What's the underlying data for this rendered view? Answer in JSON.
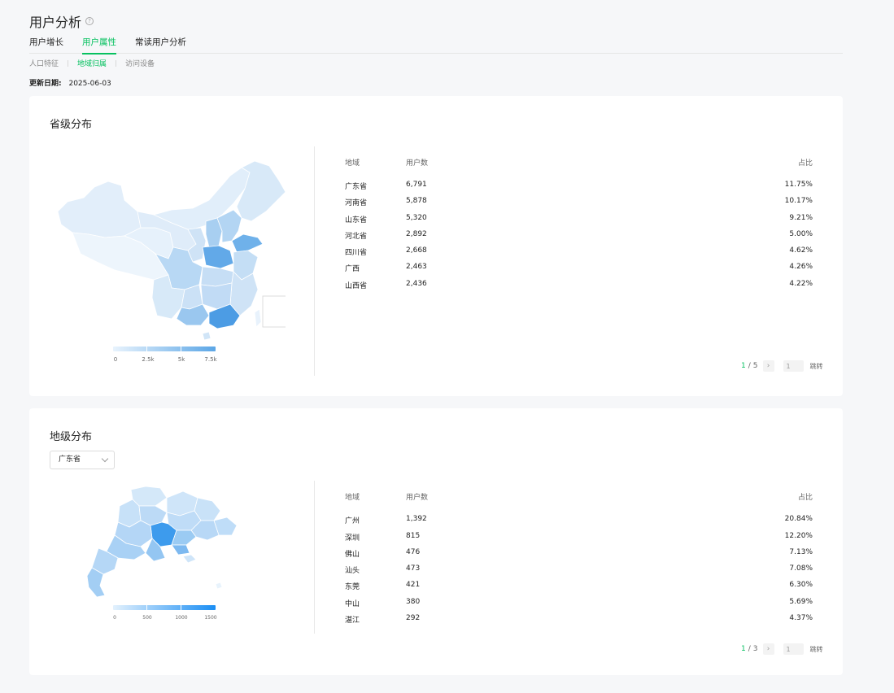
{
  "page": {
    "title": "用户分析",
    "help_icon": "question-circle-icon"
  },
  "main_tabs": [
    {
      "label": "用户增长",
      "active": false
    },
    {
      "label": "用户属性",
      "active": true
    },
    {
      "label": "常读用户分析",
      "active": false
    }
  ],
  "sub_tabs": [
    {
      "label": "人口特征",
      "active": false
    },
    {
      "label": "地域归属",
      "active": true
    },
    {
      "label": "访问设备",
      "active": false
    }
  ],
  "update": {
    "label": "更新日期:",
    "date": "2025-06-03"
  },
  "province_card": {
    "title": "省级分布",
    "legend": [
      "0",
      "2.5k",
      "5k",
      "7.5k"
    ],
    "columns": {
      "region": "地域",
      "users": "用户数",
      "pct": "占比"
    },
    "rows": [
      {
        "region": "广东省",
        "users": "6,791",
        "pct": "11.75%"
      },
      {
        "region": "河南省",
        "users": "5,878",
        "pct": "10.17%"
      },
      {
        "region": "山东省",
        "users": "5,320",
        "pct": "9.21%"
      },
      {
        "region": "河北省",
        "users": "2,892",
        "pct": "5.00%"
      },
      {
        "region": "四川省",
        "users": "2,668",
        "pct": "4.62%"
      },
      {
        "region": "广西",
        "users": "2,463",
        "pct": "4.26%"
      },
      {
        "region": "山西省",
        "users": "2,436",
        "pct": "4.22%"
      }
    ],
    "pager": {
      "current": "1",
      "total": "5",
      "separator": "/",
      "next": "›",
      "input_value": "1",
      "jump": "跳转"
    }
  },
  "city_card": {
    "title": "地级分布",
    "select": {
      "value": "广东省"
    },
    "legend": [
      "0",
      "500",
      "1000",
      "1500"
    ],
    "columns": {
      "region": "地域",
      "users": "用户数",
      "pct": "占比"
    },
    "rows": [
      {
        "region": "广州",
        "users": "1,392",
        "pct": "20.84%"
      },
      {
        "region": "深圳",
        "users": "815",
        "pct": "12.20%"
      },
      {
        "region": "佛山",
        "users": "476",
        "pct": "7.13%"
      },
      {
        "region": "汕头",
        "users": "473",
        "pct": "7.08%"
      },
      {
        "region": "东莞",
        "users": "421",
        "pct": "6.30%"
      },
      {
        "region": "中山",
        "users": "380",
        "pct": "5.69%"
      },
      {
        "region": "湛江",
        "users": "292",
        "pct": "4.37%"
      }
    ],
    "pager": {
      "current": "1",
      "total": "3",
      "separator": "/",
      "next": "›",
      "input_value": "1",
      "jump": "跳转"
    }
  },
  "colors": {
    "accent": "#07c160",
    "map_light": "#e4f0fb",
    "map_dark": "#5ba6e6",
    "city_dark": "#1a8ef4"
  }
}
